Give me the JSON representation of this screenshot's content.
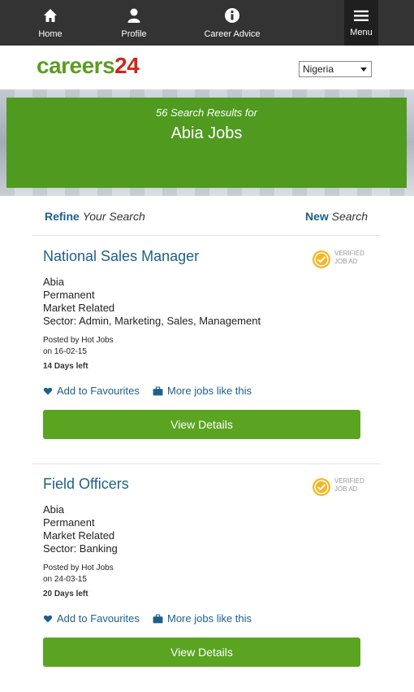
{
  "nav": {
    "items": [
      {
        "label": "Home",
        "icon": "home-icon"
      },
      {
        "label": "Profile",
        "icon": "user-icon"
      },
      {
        "label": "Career Advice",
        "icon": "info-icon"
      }
    ],
    "menu_label": "Menu"
  },
  "brand": {
    "logo_part1": "careers",
    "logo_part2": "24",
    "green": "#5a9e1f",
    "red": "#d0261d"
  },
  "country": {
    "selected": "Nigeria"
  },
  "banner": {
    "subtitle": "56 Search Results for",
    "title": "Abia Jobs",
    "color": "#4f9a1f"
  },
  "search_bar": {
    "refine_bold": "Refine",
    "refine_rest": "Your Search",
    "new_bold": "New",
    "new_rest": "Search"
  },
  "verified": {
    "line1": "VERIFIED",
    "line2": "JOB AD"
  },
  "jobs": [
    {
      "title": "National Sales Manager",
      "location": "Abia",
      "type": "Permanent",
      "salary": "Market Related",
      "sector": "Sector: Admin, Marketing, Sales, Management",
      "posted_by": "Posted by Hot Jobs",
      "posted_on": "on 16-02-15",
      "days_left": "14 Days left",
      "fav_label": "Add to Favourites",
      "more_label": "More jobs like this",
      "button_label": "View Details"
    },
    {
      "title": "Field Officers",
      "location": "Abia",
      "type": "Permanent",
      "salary": "Market Related",
      "sector": "Sector: Banking",
      "posted_by": "Posted by Hot Jobs",
      "posted_on": "on 24-03-15",
      "days_left": "20 Days left",
      "fav_label": "Add to Favourites",
      "more_label": "More jobs like this",
      "button_label": "View Details"
    }
  ]
}
